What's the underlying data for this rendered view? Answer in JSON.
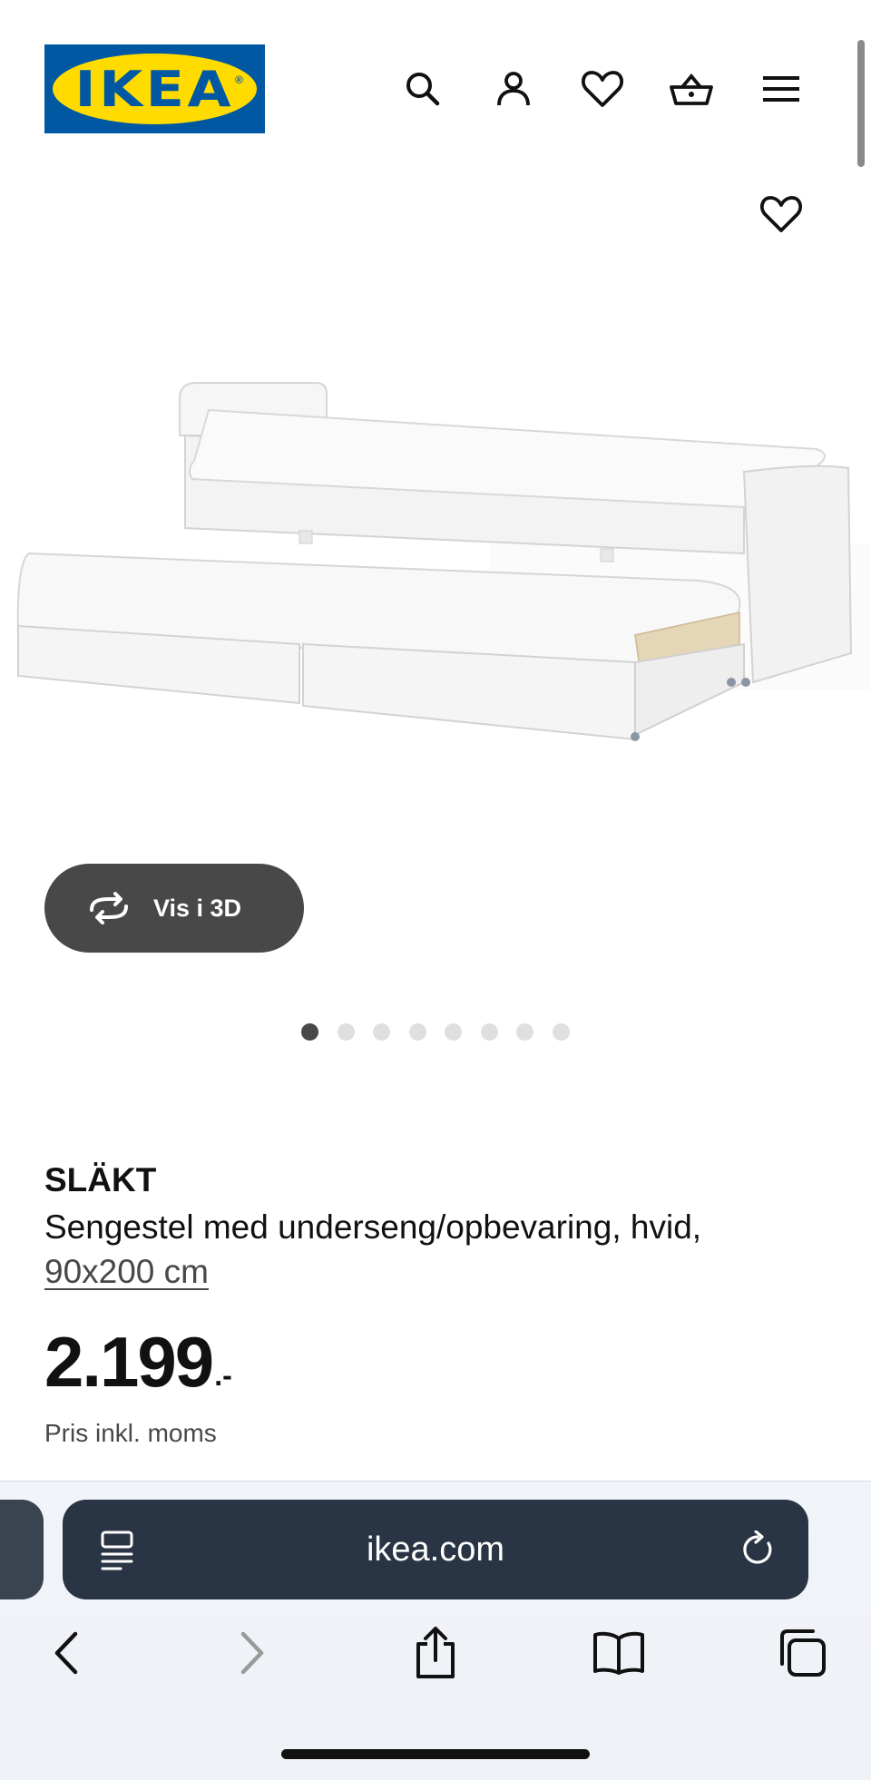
{
  "header": {
    "logo_text": "IKEA",
    "logo_reg": "®",
    "icons": [
      "search-icon",
      "account-icon",
      "favourites-icon",
      "basket-icon",
      "menu-icon"
    ]
  },
  "product": {
    "view3d_label": "Vis i 3D",
    "carousel": {
      "total": 8,
      "active": 1
    },
    "name": "SLÄKT",
    "description": "Sengestel med underseng/opbevaring, hvid,",
    "size": "90x200 cm",
    "price_integer": "2.199",
    "price_decimal": ".-",
    "price_note": "Pris inkl. moms"
  },
  "browser": {
    "url": "ikea.com",
    "toolbar_icons": [
      "back-icon",
      "forward-icon",
      "share-icon",
      "bookmarks-icon",
      "tabs-icon"
    ]
  },
  "colors": {
    "ikea_blue": "#0058a3",
    "ikea_yellow": "#ffdb00",
    "button_dark": "#484848",
    "url_bar": "#293444"
  }
}
